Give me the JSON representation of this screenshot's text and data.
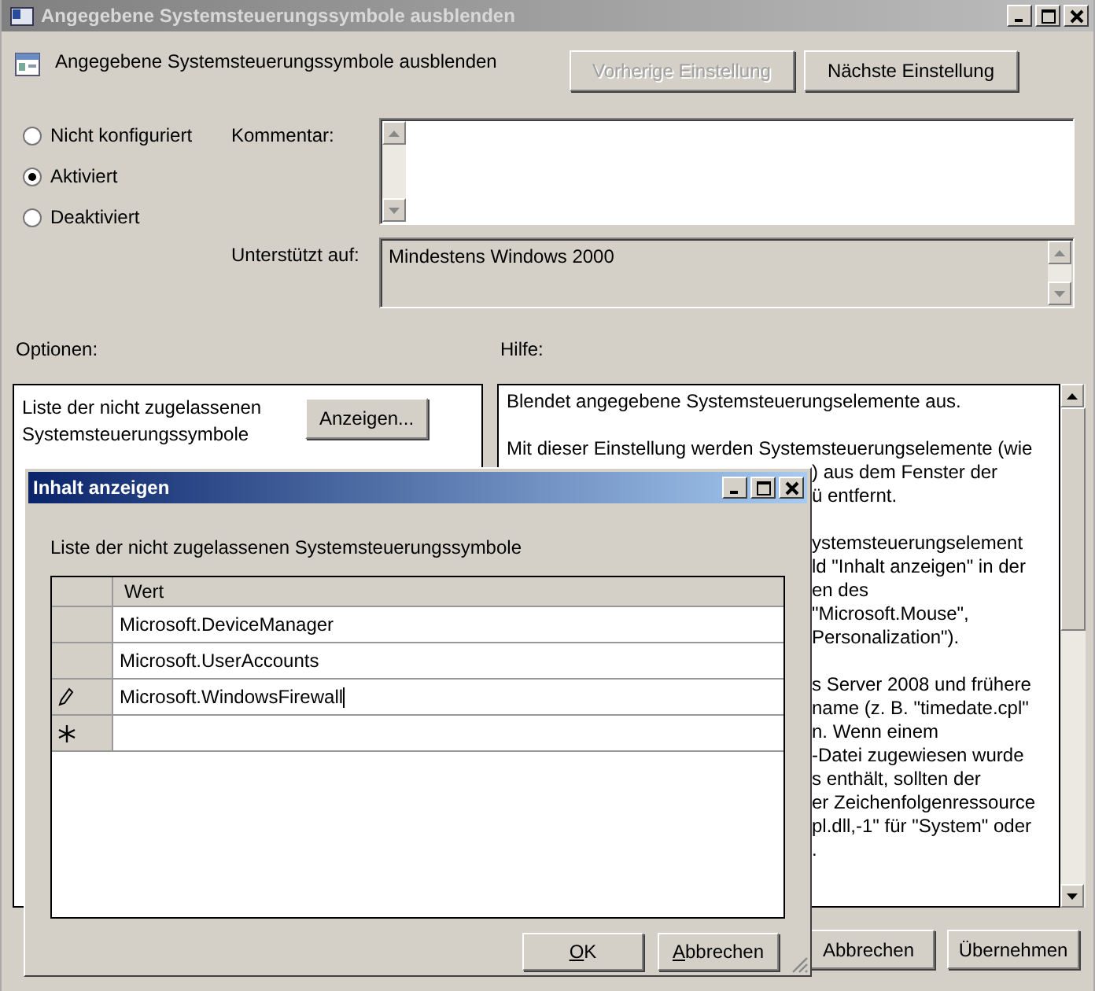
{
  "window": {
    "title": "Angegebene Systemsteuerungssymbole ausblenden"
  },
  "heading": "Angegebene Systemsteuerungssymbole ausblenden",
  "nav_buttons": [
    {
      "label": "Vorherige Einstellung",
      "disabled": true
    },
    {
      "label": "Nächste Einstellung",
      "disabled": false
    }
  ],
  "state_options": [
    {
      "label": "Nicht konfiguriert",
      "selected": false
    },
    {
      "label": "Aktiviert",
      "selected": true
    },
    {
      "label": "Deaktiviert",
      "selected": false
    }
  ],
  "comment": {
    "label": "Kommentar:"
  },
  "supported": {
    "label": "Unterstützt auf:",
    "value": "Mindestens Windows 2000"
  },
  "options_label": "Optionen:",
  "help_label": "Hilfe:",
  "option": {
    "label": "Liste der nicht zugelassenen Systemsteuerungssymbole",
    "button": "Anzeigen..."
  },
  "help_lines": [
    {
      "text": "Blendet angegebene Systemsteuerungselemente aus.",
      "partial": false
    },
    {
      "text": "Mit dieser Einstellung werden Systemsteuerungselemente (wie",
      "partial": false
    },
    {
      "text": ") aus dem Fenster der",
      "partial": true
    },
    {
      "text": "ü entfernt.",
      "partial": true
    },
    {
      "text": "ystemsteuerungselement",
      "partial": true
    },
    {
      "text": "ld \"Inhalt anzeigen\" in der",
      "partial": true
    },
    {
      "text": "en des",
      "partial": true
    },
    {
      "text": "\"Microsoft.Mouse\",",
      "partial": true
    },
    {
      "text": "Personalization\").",
      "partial": true
    },
    {
      "text": "s Server 2008 und frühere",
      "partial": true
    },
    {
      "text": "name (z. B. \"timedate.cpl\"",
      "partial": true
    },
    {
      "text": "n. Wenn einem",
      "partial": true
    },
    {
      "text": "-Datei zugewiesen wurde",
      "partial": true
    },
    {
      "text": "s enthält, sollten der",
      "partial": true
    },
    {
      "text": "er Zeichenfolgenressource",
      "partial": true
    },
    {
      "text": "pl.dll,-1\" für \"System\" oder",
      "partial": true
    },
    {
      "text": ".",
      "partial": true
    }
  ],
  "buttons": [
    "Abbrechen",
    "Übernehmen"
  ],
  "dialog": {
    "title": "Inhalt anzeigen",
    "label": "Liste der nicht zugelassenen Systemsteuerungssymbole",
    "column": "Wert",
    "rows": [
      {
        "value": "Microsoft.DeviceManager",
        "editing": false
      },
      {
        "value": "Microsoft.UserAccounts",
        "editing": false
      },
      {
        "value": "Microsoft.WindowsFirewall",
        "editing": true
      }
    ],
    "new_row": true,
    "buttons": [
      {
        "label": "OK",
        "underline_first": true
      },
      {
        "label": "Abbrechen",
        "underline_first": true
      }
    ]
  }
}
